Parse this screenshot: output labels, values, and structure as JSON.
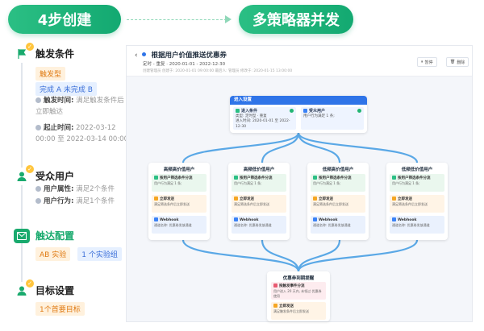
{
  "banner": {
    "left": "4步创建",
    "right": "多策略器并发"
  },
  "steps": [
    {
      "title": "触发条件",
      "tags": [
        "触发型",
        "完成 A 未完成 B"
      ],
      "trigger_label": "触发时间:",
      "trigger_value_1": "满足触发条件后",
      "trigger_value_2": "立即触达",
      "period_label": "起止时间:",
      "period_value_1": "2022-03-12",
      "period_value_2": "00:00 至 2022-03-14 00:00"
    },
    {
      "title": "受众用户",
      "attr_label": "用户属性:",
      "attr_value": "满足2个条件",
      "behavior_label": "用户行为:",
      "behavior_value": "满足1个条件"
    },
    {
      "title": "触达配置",
      "tags": [
        "AB 实验",
        "1 个实验组"
      ]
    },
    {
      "title": "目标设置",
      "tags": [
        "1个首要目标"
      ]
    }
  ],
  "panel": {
    "title": "根据用户价值推送优惠券",
    "subtitle": "定时 - 重复  ·  2020-01-01 - 2022-12-30",
    "meta": "创建管理员 创建于: 2020-01-01 09:00:00    最后人: 管理员 修改于: 2020-01-15 13:00:00",
    "btn_pause": "暂停",
    "btn_delete": "删除",
    "entry": {
      "header": "进入设置",
      "cond_label": "进入条件",
      "cond_l1": "类型: 定时型 · 重复",
      "cond_l2": "进入时间: 2020-01-01 至 2022-12-30",
      "aud_label": "受众用户",
      "aud_l1": "用户行为满足 1 条;"
    },
    "cards": [
      {
        "title": "高频高价值用户",
        "c1_label": "按用户筛选条件分流",
        "c1_sub": "用户行为满足 1 条;",
        "c2_label": "立即发送",
        "c2_sub": "满足筛选条件后立即发送",
        "c3_label": "Webhook",
        "c3_sub": "通道名称: 优惠卷发放通道"
      },
      {
        "title": "高频低价值用户",
        "c1_label": "按用户筛选条件分流",
        "c1_sub": "用户行为满足 1 条;",
        "c2_label": "立即发送",
        "c2_sub": "满足筛选条件后立即发送",
        "c3_label": "Webhook",
        "c3_sub": "通道名称: 优惠卷发放通道"
      },
      {
        "title": "低频高价值用户",
        "c1_label": "按用户筛选条件分流",
        "c1_sub": "用户行为满足 1 条;",
        "c2_label": "立即发送",
        "c2_sub": "满足筛选条件后立即发送",
        "c3_label": "Webhook",
        "c3_sub": "通道名称: 优惠卷发放通道"
      },
      {
        "title": "低频低价值用户",
        "c1_label": "按用户筛选条件分流",
        "c1_sub": "用户行为满足 1 条;",
        "c2_label": "立即发送",
        "c2_sub": "满足筛选条件后立即发送",
        "c3_label": "Webhook",
        "c3_sub": "通道名称: 优惠卷发放通道"
      }
    ],
    "final": {
      "title": "优惠券到期提醒",
      "c1_label": "按触发事件分流",
      "c1_sub": "用户进入 20 天内, 未领过 优惠券使用",
      "c2_label": "立即发送",
      "c2_sub": "满足触发条件后立即发送"
    }
  },
  "colors": {
    "brand_green": "#1aaa6e",
    "entry_blue": "#2f74e8",
    "connector": "#5aa8e6"
  }
}
